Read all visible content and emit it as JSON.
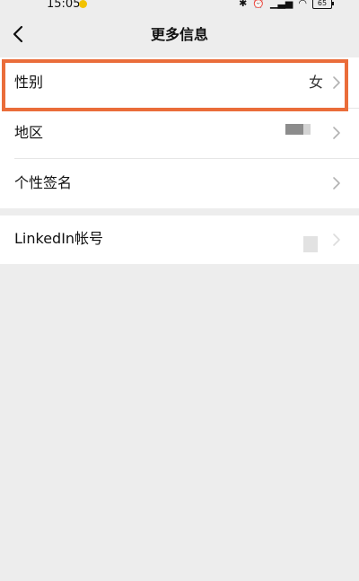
{
  "status_bar": {
    "time": "15:05",
    "battery": "65"
  },
  "nav": {
    "title": "更多信息"
  },
  "rows": [
    {
      "label": "性别",
      "value": "女"
    },
    {
      "label": "地区",
      "value": ""
    },
    {
      "label": "个性签名",
      "value": ""
    },
    {
      "label": "LinkedIn帐号",
      "value": ""
    }
  ],
  "icons": {
    "back": "chevron-left-icon",
    "row_arrow": "chevron-right-icon"
  },
  "colors": {
    "background": "#ededed",
    "card": "#ffffff",
    "highlight": "#ea6d3a"
  }
}
